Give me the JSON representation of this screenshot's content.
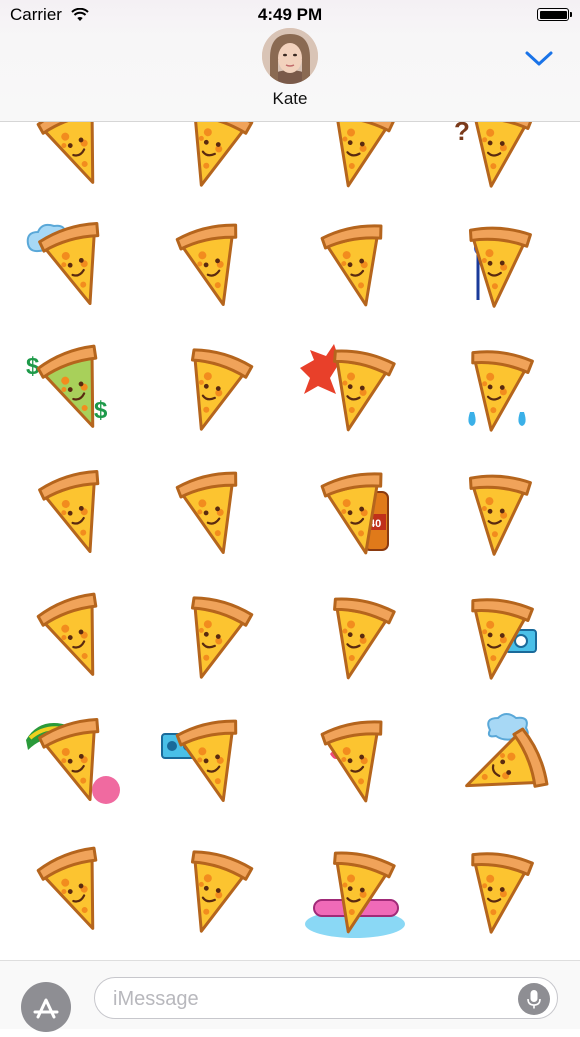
{
  "status_bar": {
    "carrier": "Carrier",
    "time": "4:49 PM",
    "wifi_icon": "wifi-icon",
    "battery_icon": "battery-icon"
  },
  "header": {
    "contact_name": "Kate",
    "avatar_icon": "avatar",
    "collapse_icon": "chevron-down-icon"
  },
  "stickers": {
    "row_labels": [
      "$",
      "$",
      "40",
      "?"
    ],
    "items": [
      "pizza-heart-eyes",
      "pizza-talking",
      "pizza-waving",
      "pizza-glasses-question",
      "pizza-thinking",
      "pizza-shocked",
      "pizza-eating",
      "pizza-singing",
      "pizza-money",
      "pizza-fork-knife",
      "pizza-cool-glasses",
      "pizza-crying",
      "pizza-angry",
      "pizza-hands-hips",
      "pizza-drink-40",
      "pizza-facepalm",
      "pizza-laughing",
      "pizza-shrug",
      "pizza-hug",
      "pizza-camera",
      "pizza-rasta-peace",
      "pizza-boombox",
      "pizza-love",
      "pizza-sleeping",
      "pizza-hello",
      "pizza-tongue",
      "pizza-pool-float",
      "pizza-plain"
    ]
  },
  "input_bar": {
    "placeholder": "iMessage",
    "apps_icon": "app-store-icon",
    "mic_icon": "microphone-icon"
  },
  "colors": {
    "accent": "#1a73e8",
    "crust": "#f0a35a",
    "cheese": "#fcc430",
    "outline": "#b5651d"
  }
}
